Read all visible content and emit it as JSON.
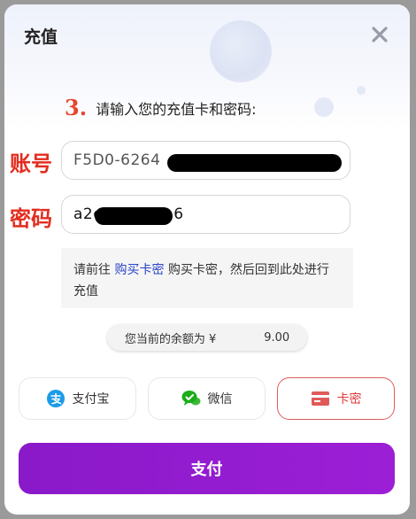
{
  "dialog": {
    "title": "充值"
  },
  "step": {
    "number": "3.",
    "text": "请输入您的充值卡和密码:"
  },
  "account": {
    "label": "账号",
    "value": "F5D0-6264"
  },
  "password": {
    "label": "密码",
    "value_start": "a2e",
    "value_end": "6"
  },
  "tip": {
    "prefix": "请前往",
    "link": "购买卡密",
    "suffix": "购买卡密，然后回到此处进行充值"
  },
  "balance": {
    "prefix": "您当前的余额为 ¥",
    "suffix": "9.00"
  },
  "payment_methods": [
    {
      "label": "支付宝",
      "icon": "alipay-icon",
      "color": "#1a9be8"
    },
    {
      "label": "微信",
      "icon": "wechat-icon",
      "color": "#1aad19"
    },
    {
      "label": "卡密",
      "icon": "card-icon",
      "color": "#e05a5a",
      "selected": true
    }
  ],
  "pay_button": {
    "label": "支付"
  }
}
